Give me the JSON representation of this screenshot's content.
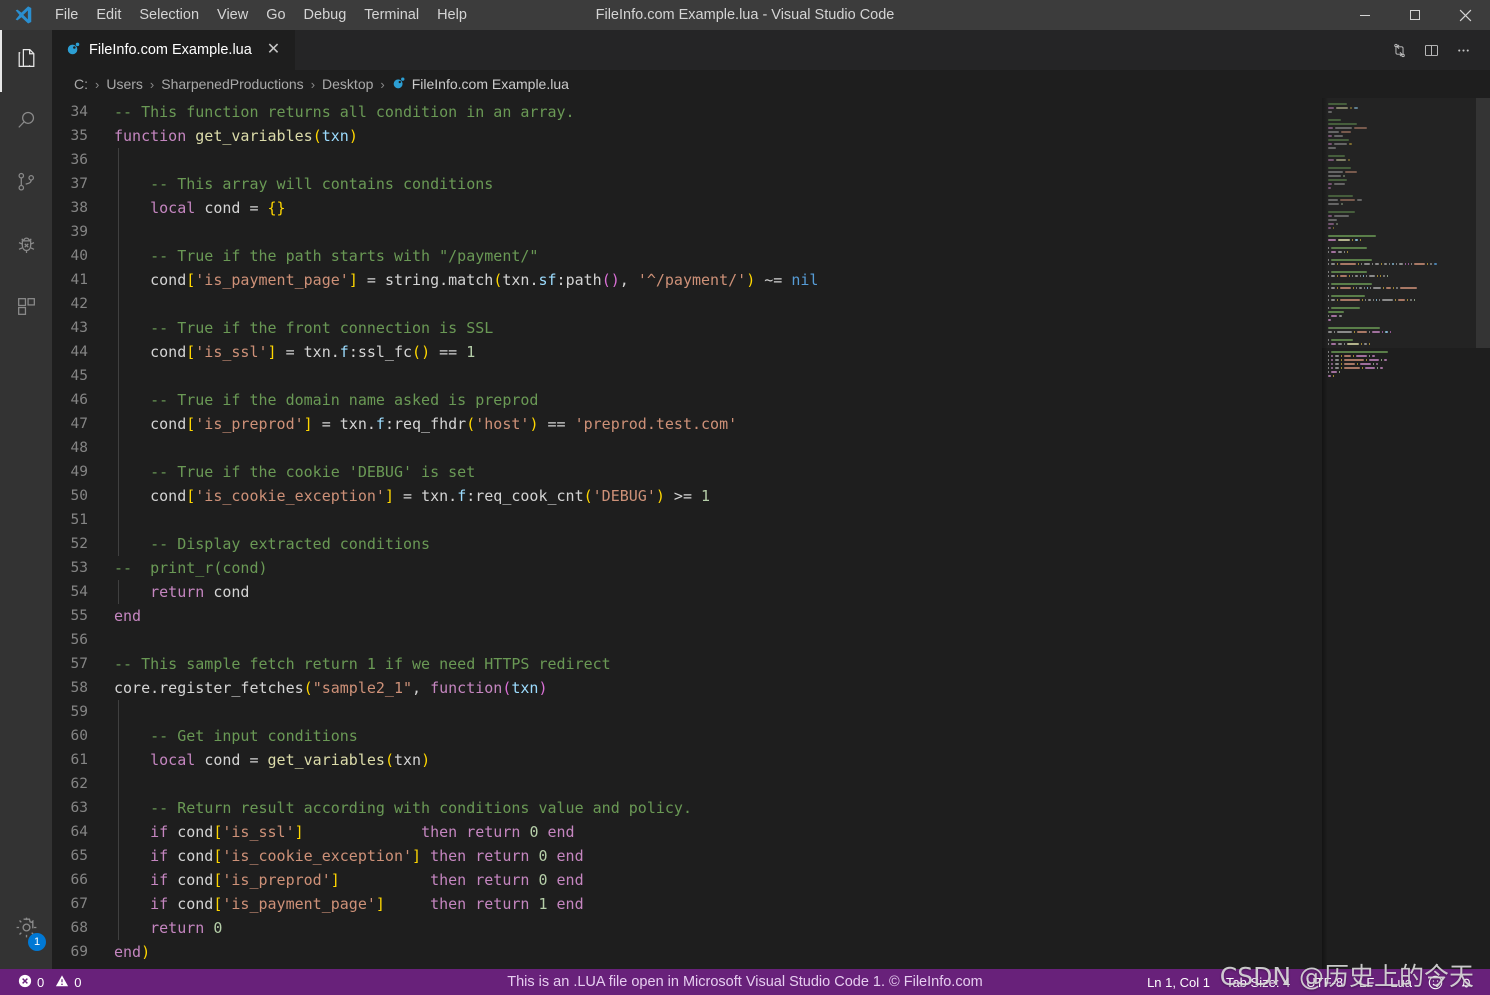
{
  "window": {
    "title": "FileInfo.com Example.lua - Visual Studio Code",
    "minimize_label": "─",
    "maximize_label": "☐",
    "close_label": "✕"
  },
  "menubar": {
    "items": [
      {
        "label": "File"
      },
      {
        "label": "Edit"
      },
      {
        "label": "Selection"
      },
      {
        "label": "View"
      },
      {
        "label": "Go"
      },
      {
        "label": "Debug"
      },
      {
        "label": "Terminal"
      },
      {
        "label": "Help"
      }
    ]
  },
  "activitybar": {
    "items": [
      {
        "name": "explorer",
        "icon": "files-icon",
        "active": true
      },
      {
        "name": "search",
        "icon": "search-icon",
        "active": false
      },
      {
        "name": "source-control",
        "icon": "source-control-icon",
        "active": false
      },
      {
        "name": "debug",
        "icon": "debug-bug-icon",
        "active": false
      },
      {
        "name": "extensions",
        "icon": "extensions-icon",
        "active": false
      }
    ],
    "manage": {
      "icon": "gear-icon",
      "badge": "1"
    }
  },
  "tabs": {
    "active_tab": "FileInfo.com Example.lua",
    "close_label": "✕",
    "actions": [
      {
        "name": "split-editor-compare",
        "icon": "compare-changes-icon"
      },
      {
        "name": "split-editor",
        "icon": "split-editor-icon"
      },
      {
        "name": "more-actions",
        "icon": "ellipsis-icon"
      }
    ]
  },
  "breadcrumbs": {
    "separator": "›",
    "items": [
      "C:",
      "Users",
      "SharpenedProductions",
      "Desktop",
      "FileInfo.com Example.lua"
    ]
  },
  "editor": {
    "language": "Lua",
    "first_line": 34,
    "lines": [
      {
        "n": 34,
        "indent": 0,
        "guides": 0,
        "tokens": [
          {
            "t": "-- This function returns all condition in an array.",
            "c": "c"
          }
        ]
      },
      {
        "n": 35,
        "indent": 0,
        "guides": 0,
        "tokens": [
          {
            "t": "function ",
            "c": "kw"
          },
          {
            "t": "get_variables",
            "c": "fn"
          },
          {
            "t": "(",
            "c": "pg"
          },
          {
            "t": "txn",
            "c": "var"
          },
          {
            "t": ")",
            "c": "pg"
          }
        ]
      },
      {
        "n": 36,
        "indent": 0,
        "guides": 1,
        "tokens": []
      },
      {
        "n": 37,
        "indent": 4,
        "guides": 1,
        "tokens": [
          {
            "t": "-- This array will contains conditions",
            "c": "c"
          }
        ]
      },
      {
        "n": 38,
        "indent": 4,
        "guides": 1,
        "tokens": [
          {
            "t": "local ",
            "c": "kw"
          },
          {
            "t": "cond ",
            "c": "p"
          },
          {
            "t": "= ",
            "c": "op"
          },
          {
            "t": "{}",
            "c": "pg"
          }
        ]
      },
      {
        "n": 39,
        "indent": 0,
        "guides": 1,
        "tokens": []
      },
      {
        "n": 40,
        "indent": 4,
        "guides": 1,
        "tokens": [
          {
            "t": "-- True if the path starts with \"/payment/\"",
            "c": "c"
          }
        ]
      },
      {
        "n": 41,
        "indent": 4,
        "guides": 1,
        "tokens": [
          {
            "t": "cond",
            "c": "p"
          },
          {
            "t": "[",
            "c": "pg"
          },
          {
            "t": "'is_payment_page'",
            "c": "str"
          },
          {
            "t": "]",
            "c": "pg"
          },
          {
            "t": " = ",
            "c": "op"
          },
          {
            "t": "string",
            "c": "p"
          },
          {
            "t": ".",
            "c": "op"
          },
          {
            "t": "match",
            "c": "p"
          },
          {
            "t": "(",
            "c": "pg"
          },
          {
            "t": "txn",
            "c": "p"
          },
          {
            "t": ".",
            "c": "op"
          },
          {
            "t": "sf",
            "c": "var"
          },
          {
            "t": ":",
            "c": "op"
          },
          {
            "t": "path",
            "c": "p"
          },
          {
            "t": "(",
            "c": "pp"
          },
          {
            "t": ")",
            "c": "pp"
          },
          {
            "t": ", ",
            "c": "op"
          },
          {
            "t": "'^/payment/'",
            "c": "str"
          },
          {
            "t": ")",
            "c": "pg"
          },
          {
            "t": " ~= ",
            "c": "op"
          },
          {
            "t": "nil",
            "c": "nil"
          }
        ]
      },
      {
        "n": 42,
        "indent": 0,
        "guides": 1,
        "tokens": []
      },
      {
        "n": 43,
        "indent": 4,
        "guides": 1,
        "tokens": [
          {
            "t": "-- True if the front connection is SSL",
            "c": "c"
          }
        ]
      },
      {
        "n": 44,
        "indent": 4,
        "guides": 1,
        "tokens": [
          {
            "t": "cond",
            "c": "p"
          },
          {
            "t": "[",
            "c": "pg"
          },
          {
            "t": "'is_ssl'",
            "c": "str"
          },
          {
            "t": "]",
            "c": "pg"
          },
          {
            "t": " = ",
            "c": "op"
          },
          {
            "t": "txn",
            "c": "p"
          },
          {
            "t": ".",
            "c": "op"
          },
          {
            "t": "f",
            "c": "var"
          },
          {
            "t": ":",
            "c": "op"
          },
          {
            "t": "ssl_fc",
            "c": "p"
          },
          {
            "t": "(",
            "c": "pg"
          },
          {
            "t": ")",
            "c": "pg"
          },
          {
            "t": " == ",
            "c": "op"
          },
          {
            "t": "1",
            "c": "num"
          }
        ]
      },
      {
        "n": 45,
        "indent": 0,
        "guides": 1,
        "tokens": []
      },
      {
        "n": 46,
        "indent": 4,
        "guides": 1,
        "tokens": [
          {
            "t": "-- True if the domain name asked is preprod",
            "c": "c"
          }
        ]
      },
      {
        "n": 47,
        "indent": 4,
        "guides": 1,
        "tokens": [
          {
            "t": "cond",
            "c": "p"
          },
          {
            "t": "[",
            "c": "pg"
          },
          {
            "t": "'is_preprod'",
            "c": "str"
          },
          {
            "t": "]",
            "c": "pg"
          },
          {
            "t": " = ",
            "c": "op"
          },
          {
            "t": "txn",
            "c": "p"
          },
          {
            "t": ".",
            "c": "op"
          },
          {
            "t": "f",
            "c": "var"
          },
          {
            "t": ":",
            "c": "op"
          },
          {
            "t": "req_fhdr",
            "c": "p"
          },
          {
            "t": "(",
            "c": "pg"
          },
          {
            "t": "'host'",
            "c": "str"
          },
          {
            "t": ")",
            "c": "pg"
          },
          {
            "t": " == ",
            "c": "op"
          },
          {
            "t": "'preprod.test.com'",
            "c": "str"
          }
        ]
      },
      {
        "n": 48,
        "indent": 0,
        "guides": 1,
        "tokens": []
      },
      {
        "n": 49,
        "indent": 4,
        "guides": 1,
        "tokens": [
          {
            "t": "-- True if the cookie 'DEBUG' is set",
            "c": "c"
          }
        ]
      },
      {
        "n": 50,
        "indent": 4,
        "guides": 1,
        "tokens": [
          {
            "t": "cond",
            "c": "p"
          },
          {
            "t": "[",
            "c": "pg"
          },
          {
            "t": "'is_cookie_exception'",
            "c": "str"
          },
          {
            "t": "]",
            "c": "pg"
          },
          {
            "t": " = ",
            "c": "op"
          },
          {
            "t": "txn",
            "c": "p"
          },
          {
            "t": ".",
            "c": "op"
          },
          {
            "t": "f",
            "c": "var"
          },
          {
            "t": ":",
            "c": "op"
          },
          {
            "t": "req_cook_cnt",
            "c": "p"
          },
          {
            "t": "(",
            "c": "pg"
          },
          {
            "t": "'DEBUG'",
            "c": "str"
          },
          {
            "t": ")",
            "c": "pg"
          },
          {
            "t": " >= ",
            "c": "op"
          },
          {
            "t": "1",
            "c": "num"
          }
        ]
      },
      {
        "n": 51,
        "indent": 0,
        "guides": 1,
        "tokens": []
      },
      {
        "n": 52,
        "indent": 4,
        "guides": 1,
        "tokens": [
          {
            "t": "-- Display extracted conditions",
            "c": "c"
          }
        ]
      },
      {
        "n": 53,
        "indent": 0,
        "guides": 0,
        "tokens": [
          {
            "t": "--  print_r(cond)",
            "c": "c"
          }
        ]
      },
      {
        "n": 54,
        "indent": 4,
        "guides": 1,
        "tokens": [
          {
            "t": "return ",
            "c": "kw"
          },
          {
            "t": "cond",
            "c": "p"
          }
        ]
      },
      {
        "n": 55,
        "indent": 0,
        "guides": 0,
        "tokens": [
          {
            "t": "end",
            "c": "kw"
          }
        ]
      },
      {
        "n": 56,
        "indent": 0,
        "guides": 0,
        "tokens": []
      },
      {
        "n": 57,
        "indent": 0,
        "guides": 0,
        "tokens": [
          {
            "t": "-- This sample fetch return 1 if we need HTTPS redirect",
            "c": "c"
          }
        ]
      },
      {
        "n": 58,
        "indent": 0,
        "guides": 0,
        "tokens": [
          {
            "t": "core",
            "c": "p"
          },
          {
            "t": ".",
            "c": "op"
          },
          {
            "t": "register_fetches",
            "c": "p"
          },
          {
            "t": "(",
            "c": "pg"
          },
          {
            "t": "\"sample2_1\"",
            "c": "str"
          },
          {
            "t": ", ",
            "c": "op"
          },
          {
            "t": "function",
            "c": "kw"
          },
          {
            "t": "(",
            "c": "pp"
          },
          {
            "t": "txn",
            "c": "var"
          },
          {
            "t": ")",
            "c": "pp"
          }
        ]
      },
      {
        "n": 59,
        "indent": 0,
        "guides": 1,
        "tokens": []
      },
      {
        "n": 60,
        "indent": 4,
        "guides": 1,
        "tokens": [
          {
            "t": "-- Get input conditions",
            "c": "c"
          }
        ]
      },
      {
        "n": 61,
        "indent": 4,
        "guides": 1,
        "tokens": [
          {
            "t": "local ",
            "c": "kw"
          },
          {
            "t": "cond ",
            "c": "p"
          },
          {
            "t": "= ",
            "c": "op"
          },
          {
            "t": "get_variables",
            "c": "fn"
          },
          {
            "t": "(",
            "c": "pg"
          },
          {
            "t": "txn",
            "c": "p"
          },
          {
            "t": ")",
            "c": "pg"
          }
        ]
      },
      {
        "n": 62,
        "indent": 0,
        "guides": 1,
        "tokens": []
      },
      {
        "n": 63,
        "indent": 4,
        "guides": 1,
        "tokens": [
          {
            "t": "-- Return result according with conditions value and policy.",
            "c": "c"
          }
        ]
      },
      {
        "n": 64,
        "indent": 4,
        "guides": 1,
        "tokens": [
          {
            "t": "if ",
            "c": "kw"
          },
          {
            "t": "cond",
            "c": "p"
          },
          {
            "t": "[",
            "c": "pg"
          },
          {
            "t": "'is_ssl'",
            "c": "str"
          },
          {
            "t": "]",
            "c": "pg"
          },
          {
            "t": "             ",
            "c": "p"
          },
          {
            "t": "then return ",
            "c": "kw"
          },
          {
            "t": "0 ",
            "c": "num"
          },
          {
            "t": "end",
            "c": "kw"
          }
        ]
      },
      {
        "n": 65,
        "indent": 4,
        "guides": 1,
        "tokens": [
          {
            "t": "if ",
            "c": "kw"
          },
          {
            "t": "cond",
            "c": "p"
          },
          {
            "t": "[",
            "c": "pg"
          },
          {
            "t": "'is_cookie_exception'",
            "c": "str"
          },
          {
            "t": "]",
            "c": "pg"
          },
          {
            "t": " ",
            "c": "p"
          },
          {
            "t": "then return ",
            "c": "kw"
          },
          {
            "t": "0 ",
            "c": "num"
          },
          {
            "t": "end",
            "c": "kw"
          }
        ]
      },
      {
        "n": 66,
        "indent": 4,
        "guides": 1,
        "tokens": [
          {
            "t": "if ",
            "c": "kw"
          },
          {
            "t": "cond",
            "c": "p"
          },
          {
            "t": "[",
            "c": "pg"
          },
          {
            "t": "'is_preprod'",
            "c": "str"
          },
          {
            "t": "]",
            "c": "pg"
          },
          {
            "t": "          ",
            "c": "p"
          },
          {
            "t": "then return ",
            "c": "kw"
          },
          {
            "t": "0 ",
            "c": "num"
          },
          {
            "t": "end",
            "c": "kw"
          }
        ]
      },
      {
        "n": 67,
        "indent": 4,
        "guides": 1,
        "tokens": [
          {
            "t": "if ",
            "c": "kw"
          },
          {
            "t": "cond",
            "c": "p"
          },
          {
            "t": "[",
            "c": "pg"
          },
          {
            "t": "'is_payment_page'",
            "c": "str"
          },
          {
            "t": "]",
            "c": "pg"
          },
          {
            "t": "     ",
            "c": "p"
          },
          {
            "t": "then return ",
            "c": "kw"
          },
          {
            "t": "1 ",
            "c": "num"
          },
          {
            "t": "end",
            "c": "kw"
          }
        ]
      },
      {
        "n": 68,
        "indent": 4,
        "guides": 1,
        "tokens": [
          {
            "t": "return ",
            "c": "kw"
          },
          {
            "t": "0",
            "c": "num"
          }
        ]
      },
      {
        "n": 69,
        "indent": 0,
        "guides": 0,
        "tokens": [
          {
            "t": "end",
            "c": "kw"
          },
          {
            "t": ")",
            "c": "pg"
          }
        ]
      }
    ]
  },
  "statusbar": {
    "errors": "0",
    "warnings": "0",
    "message": "This is an .LUA file open in Microsoft Visual Studio Code 1. © FileInfo.com",
    "cursor_position": "Ln 1, Col 1",
    "tab_size": "Tab Size: 4",
    "encoding": "UTF-8",
    "eol": "LF",
    "language_mode": "Lua",
    "feedback_icon": "smiley-icon",
    "notifications_icon": "bell-icon"
  },
  "watermark": {
    "text": "CSDN @历史上的今天"
  },
  "colors": {
    "titlebar_bg": "#3c3c3c",
    "activitybar_bg": "#333333",
    "editor_bg": "#1e1e1e",
    "tabsbar_bg": "#252526",
    "statusbar_bg": "#68217a",
    "accent_blue": "#0078d4",
    "comment_green": "#6a9955",
    "keyword_purple": "#c586c0",
    "string_orange": "#ce9178",
    "function_yellow": "#dcdcaa",
    "variable_blue": "#9cdcfe",
    "number_green": "#b5cea8",
    "lua_icon_blue": "#2c9fd4"
  }
}
